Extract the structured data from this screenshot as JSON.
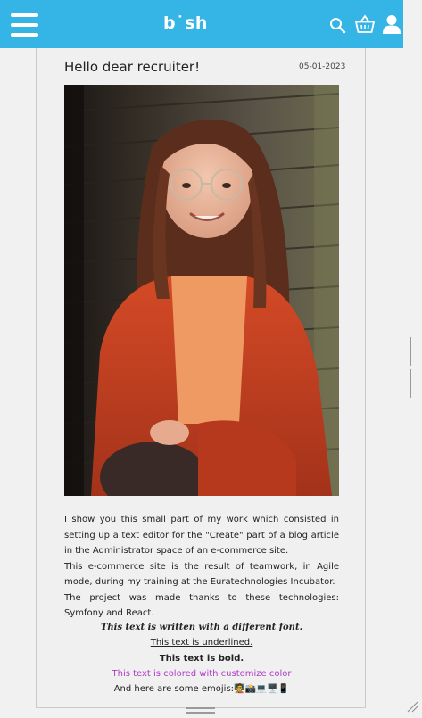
{
  "header": {
    "logo_text": "b˙sh",
    "accent_color": "#35b4e6",
    "icons": [
      "menu-icon",
      "search-icon",
      "basket-icon",
      "user-icon"
    ]
  },
  "post": {
    "title": "Hello dear recruiter!",
    "date": "05-01-2023",
    "paragraphs": [
      "I show you this small part of my work which consisted in setting up a text editor for the \"Create\" part of a blog article in the Administrator space of an e-commerce site.",
      "This e-commerce site is the result of teamwork, in Agile mode, during my training at the Euratechnologies Incubator.",
      "The project was made thanks to these technologies: Symfony and React."
    ],
    "fancy_text": "This text is written with a different font.",
    "underlined_text": "This text is underlined.",
    "bold_text": "This text is bold.",
    "colored_text": "This text is colored with customize color",
    "colored_text_color": "#b03bc7",
    "emoji_text": "And here are some emojis:",
    "emojis": "🧑‍🏫📸💻🖥️📱"
  }
}
